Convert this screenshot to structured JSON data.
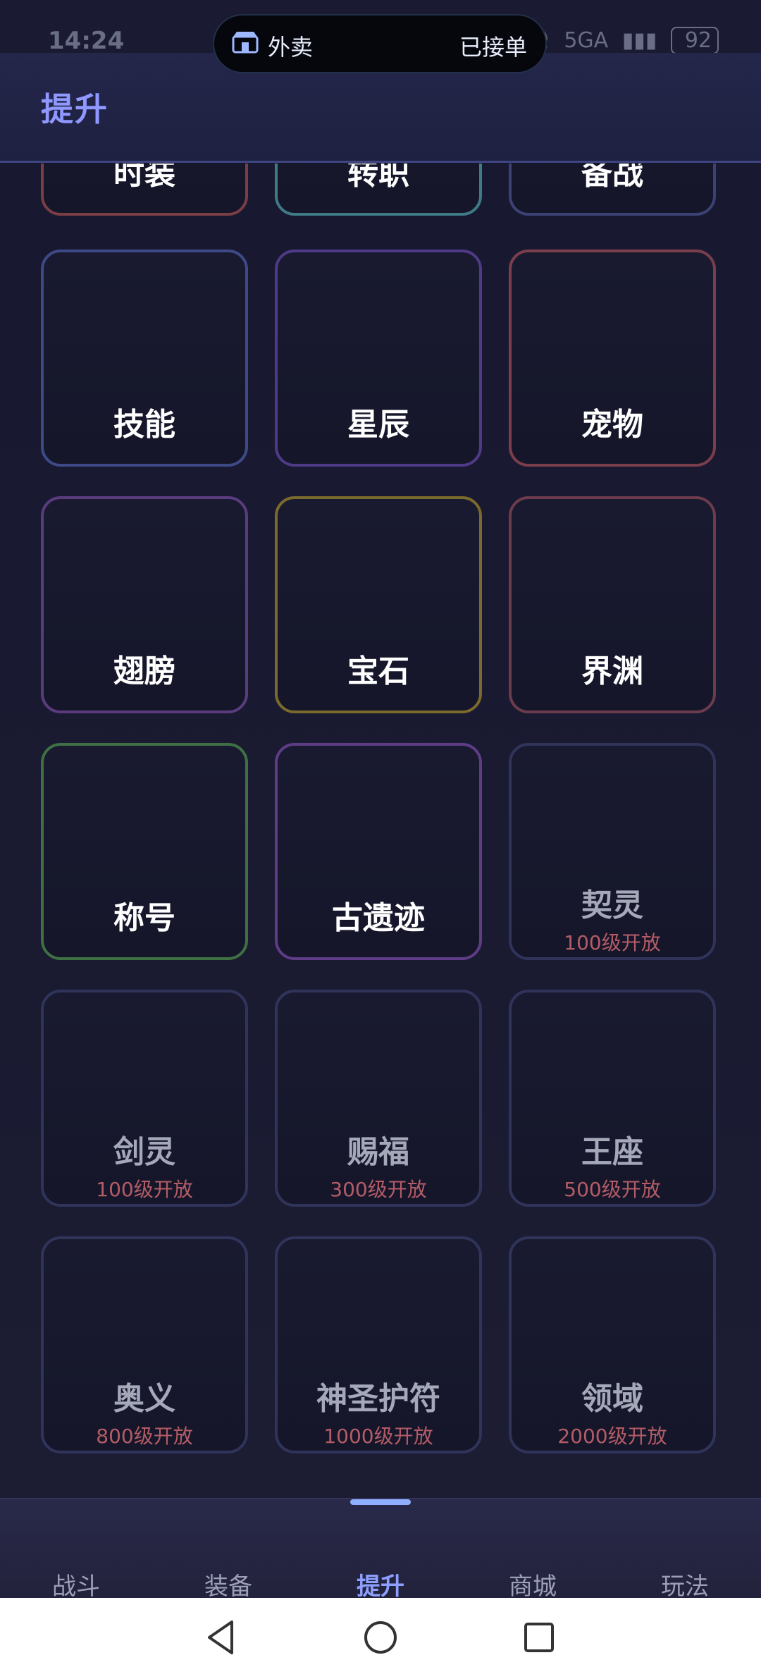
{
  "status_bar": {
    "time": "14:24",
    "battery": "92",
    "network": "5GA"
  },
  "island": {
    "left_text": "外卖",
    "right_text": "已接单"
  },
  "header": {
    "title": "提升"
  },
  "cards_top_partial": [
    {
      "label": "时装",
      "border": "#7a3e45"
    },
    {
      "label": "转职",
      "border": "#3f7a86"
    },
    {
      "label": "备战",
      "border": "#3d4275"
    }
  ],
  "cards": [
    {
      "label": "技能",
      "border": "#3d4a86",
      "icon": "skill-book-icon",
      "requirement": ""
    },
    {
      "label": "星辰",
      "border": "#4e3a86",
      "icon": "star-icon",
      "requirement": ""
    },
    {
      "label": "宠物",
      "border": "#7a3e4c",
      "icon": "pet-bird-icon",
      "requirement": ""
    },
    {
      "label": "翅膀",
      "border": "#5a3c7e",
      "icon": "wings-icon",
      "requirement": ""
    },
    {
      "label": "宝石",
      "border": "#7a6a2c",
      "icon": "gem-icon",
      "requirement": ""
    },
    {
      "label": "界渊",
      "border": "#6c3c4c",
      "icon": "abyss-stone-icon",
      "requirement": ""
    },
    {
      "label": "称号",
      "border": "#3f7044",
      "icon": "crown-shield-icon",
      "requirement": ""
    },
    {
      "label": "古遗迹",
      "border": "#5e3c86",
      "icon": "relic-compass-icon",
      "requirement": ""
    },
    {
      "label": "契灵",
      "border": "#30345a",
      "icon": "spirit-fairy-icon",
      "requirement": "100级开放",
      "locked": true
    },
    {
      "label": "剑灵",
      "border": "#30345a",
      "icon": "sword-spirit-icon",
      "requirement": "100级开放",
      "locked": true
    },
    {
      "label": "赐福",
      "border": "#30345a",
      "icon": "blessing-wings-icon",
      "requirement": "300级开放",
      "locked": true
    },
    {
      "label": "王座",
      "border": "#30345a",
      "icon": "throne-icon",
      "requirement": "500级开放",
      "locked": true
    },
    {
      "label": "奥义",
      "border": "#30345a",
      "icon": "mystic-rune-icon",
      "requirement": "800级开放",
      "locked": true
    },
    {
      "label": "神圣护符",
      "border": "#30345a",
      "icon": "holy-amulet-icon",
      "requirement": "1000级开放",
      "locked": true
    },
    {
      "label": "领域",
      "border": "#30345a",
      "icon": "domain-vortex-icon",
      "requirement": "2000级开放",
      "locked": true
    }
  ],
  "bottom_nav": [
    {
      "label": "战斗",
      "active": false
    },
    {
      "label": "装备",
      "active": false
    },
    {
      "label": "提升",
      "active": true
    },
    {
      "label": "商城",
      "active": false
    },
    {
      "label": "玩法",
      "active": false
    }
  ]
}
